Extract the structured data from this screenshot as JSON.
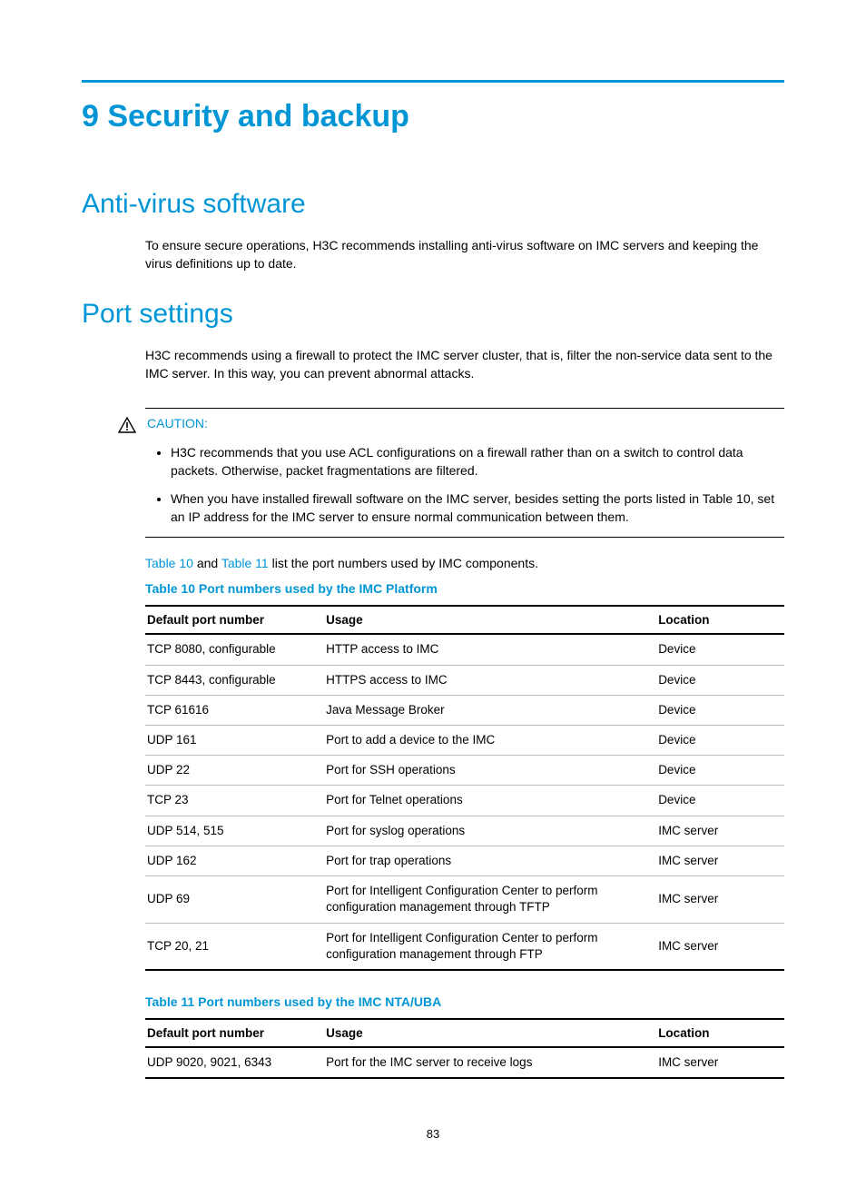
{
  "chapter": {
    "title": "9 Security and backup"
  },
  "sections": {
    "antivirus": {
      "title": "Anti-virus software",
      "body": "To ensure secure operations, H3C recommends installing anti-virus software on IMC servers and keeping the virus definitions up to date."
    },
    "portsettings": {
      "title": "Port settings",
      "body": "H3C recommends using a firewall to protect the IMC server cluster, that is, filter the non-service data sent to the IMC server. In this way, you can prevent abnormal attacks."
    }
  },
  "caution": {
    "label": "CAUTION:",
    "items": [
      "H3C recommends that you use ACL configurations on a firewall rather than on a switch to control data packets. Otherwise, packet fragmentations are filtered.",
      "When you have installed firewall software on the IMC server, besides setting the ports listed in Table 10, set an IP address for the IMC server to ensure normal communication between them."
    ]
  },
  "table_ref": {
    "link1": "Table 10",
    "mid": " and ",
    "link2": "Table 11",
    "rest": " list the port numbers used by IMC components."
  },
  "table10": {
    "title": "Table 10 Port numbers used by the IMC Platform",
    "headers": {
      "port": "Default port number",
      "usage": "Usage",
      "location": "Location"
    },
    "rows": [
      {
        "port": "TCP 8080, configurable",
        "usage": "HTTP access to IMC",
        "location": "Device"
      },
      {
        "port": "TCP 8443, configurable",
        "usage": "HTTPS access to IMC",
        "location": "Device"
      },
      {
        "port": "TCP 61616",
        "usage": "Java Message Broker",
        "location": "Device"
      },
      {
        "port": "UDP 161",
        "usage": "Port to add a device to the IMC",
        "location": "Device"
      },
      {
        "port": "UDP 22",
        "usage": "Port for SSH operations",
        "location": "Device"
      },
      {
        "port": "TCP 23",
        "usage": "Port for Telnet operations",
        "location": "Device"
      },
      {
        "port": "UDP 514, 515",
        "usage": "Port for syslog operations",
        "location": "IMC server"
      },
      {
        "port": "UDP 162",
        "usage": "Port for trap operations",
        "location": "IMC server"
      },
      {
        "port": "UDP 69",
        "usage": "Port for Intelligent Configuration Center to perform configuration management through TFTP",
        "location": "IMC server"
      },
      {
        "port": "TCP 20, 21",
        "usage": "Port for Intelligent Configuration Center to perform configuration management through FTP",
        "location": "IMC server"
      }
    ]
  },
  "table11": {
    "title": "Table 11 Port numbers used by the IMC NTA/UBA",
    "headers": {
      "port": "Default port number",
      "usage": "Usage",
      "location": "Location"
    },
    "rows": [
      {
        "port": "UDP 9020, 9021, 6343",
        "usage": "Port for the IMC server to receive logs",
        "location": "IMC server"
      }
    ]
  },
  "page_number": "83"
}
